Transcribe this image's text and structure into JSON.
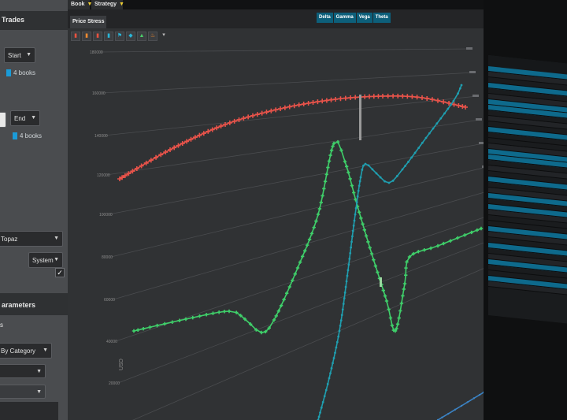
{
  "left_panel": {
    "trades_header": "Trades",
    "start_select": "Start",
    "start_books": "4 books",
    "end_select": "End",
    "end_books": "4 books",
    "topaz_select": "Topaz",
    "system_select": "System",
    "parameters_header": "arameters",
    "parameters_sub": "s",
    "category_select": "By Category"
  },
  "top_tabs": [
    {
      "label": "Book"
    },
    {
      "label": "Strategy"
    }
  ],
  "chart_tab": "Price Stress",
  "greek_buttons": [
    "Delta",
    "Gamma",
    "Vega",
    "Theta"
  ],
  "y_axis_label": "USD",
  "y_ticks": [
    "180000",
    "160000",
    "140000",
    "120000",
    "100000",
    "80000",
    "60000",
    "40000",
    "20000"
  ],
  "colors": {
    "red_series": "#e8534a",
    "green_series": "#3fd06a",
    "teal_series": "#1f9fb0",
    "blue_series": "#3b83c4",
    "highlight": "#0e6a8c"
  },
  "icons": [
    "bar-chart-red-icon",
    "bar-chart-orange-icon",
    "bar-chart-red2-icon",
    "bar-chart-teal-icon",
    "flag-cyan-icon",
    "drop-cyan-icon",
    "level-green-icon",
    "flame-orange-icon",
    "chevron-down-icon"
  ]
}
